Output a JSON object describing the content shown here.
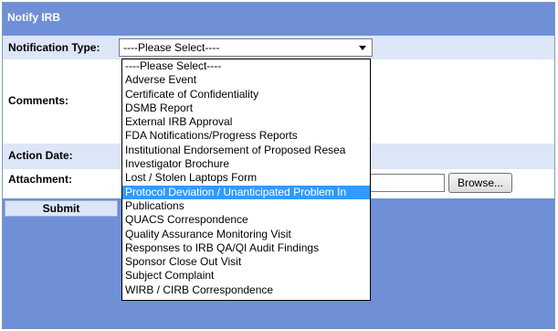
{
  "form": {
    "title": "Notify IRB",
    "notification_type_label": "Notification Type:",
    "notification_type_value": "----Please Select----",
    "comments_label": "Comments:",
    "action_date_label": "Action Date:",
    "attachment_label": "Attachment:",
    "browse_label": "Browse...",
    "submit_label": "Submit"
  },
  "dropdown": {
    "highlighted": "Protocol Deviation / Unanticipated Problem In",
    "options": [
      "----Please Select----",
      "Adverse Event",
      "Certificate of Confidentiality",
      "DSMB Report",
      "External IRB Approval",
      "FDA Notifications/Progress Reports",
      "Institutional Endorsement of Proposed Resea",
      "Investigator Brochure",
      "Lost / Stolen Laptops Form",
      "Protocol Deviation / Unanticipated Problem In",
      "Publications",
      "QUACS Correspondence",
      "Quality Assurance Monitoring Visit",
      "Responses to IRB QA/QI Audit Findings",
      "Sponsor Close Out Visit",
      "Subject Complaint",
      "WIRB / CIRB Correspondence"
    ]
  },
  "colors": {
    "header_blue": "#6f8fd6",
    "row_light": "#dce6f7",
    "highlight": "#3399ff"
  }
}
